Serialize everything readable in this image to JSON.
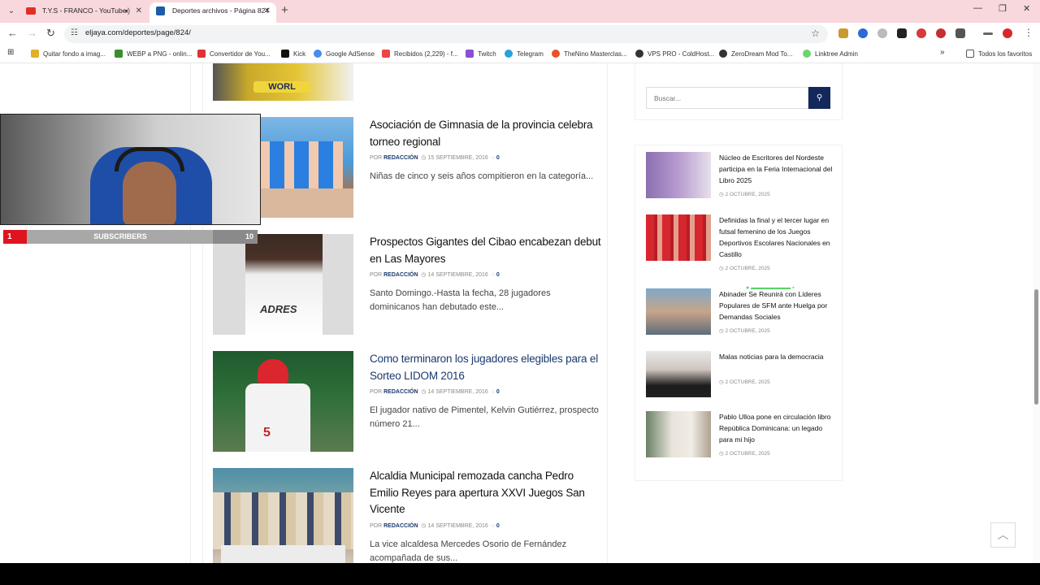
{
  "tabs": [
    {
      "title": "T.Y.S - FRANCO - YouTube"
    },
    {
      "title": "Deportes archivos - Página 824"
    }
  ],
  "address": {
    "url": "eljaya.com/deportes/page/824/"
  },
  "bookmarks": [
    {
      "label": "Quitar fondo a imag..."
    },
    {
      "label": "WEBP a PNG - onlin..."
    },
    {
      "label": "Convertidor de You..."
    },
    {
      "label": "Kick"
    },
    {
      "label": "Google AdSense"
    },
    {
      "label": "Recibidos (2,229) - f..."
    },
    {
      "label": "Twitch"
    },
    {
      "label": "Telegram"
    },
    {
      "label": "TheNino Masterclas..."
    },
    {
      "label": "VPS PRO - ColdHost..."
    },
    {
      "label": "ZeroDream Mod To..."
    },
    {
      "label": "Linktree Admin"
    }
  ],
  "bookmarks_all": "Todos los favoritos",
  "articles": [
    {
      "title": "Asociación de Gimnasia de la provincia celebra torneo regional",
      "by": "POR",
      "author": "REDACCIÓN",
      "date": "15 SEPTIEMBRE, 2016",
      "comments": "0",
      "excerpt": "Niñas de cinco y seis años compitieron en la categoría..."
    },
    {
      "title": "Prospectos Gigantes del Cibao encabezan debut en Las Mayores",
      "by": "POR",
      "author": "REDACCIÓN",
      "date": "14 SEPTIEMBRE, 2016",
      "comments": "0",
      "excerpt": "Santo Domingo.-Hasta la fecha, 28 jugadores dominicanos han debutado este..."
    },
    {
      "title": "Como terminaron los jugadores elegibles para el Sorteo LIDOM 2016",
      "by": "POR",
      "author": "REDACCIÓN",
      "date": "14 SEPTIEMBRE, 2016",
      "comments": "0",
      "excerpt": "El jugador nativo de Pimentel, Kelvin Gutiérrez, prospecto número 21..."
    },
    {
      "title": "Alcaldia Municipal remozada cancha Pedro Emilio Reyes para apertura XXVI Juegos San Vicente",
      "by": "POR",
      "author": "REDACCIÓN",
      "date": "14 SEPTIEMBRE, 2016",
      "comments": "0",
      "excerpt": "La vice alcaldesa Mercedes Osorio de Fernández acompañada de sus..."
    }
  ],
  "search": {
    "placeholder": "Buscar..."
  },
  "sidebar": [
    {
      "title": "Núcleo de Escritores del Nordeste participa en la Feria Internacional del Libro 2025",
      "date": "2 OCTUBRE, 2025"
    },
    {
      "title": "Definidas la final y el tercer lugar en futsal femenino de los Juegos Deportivos Escolares Nacionales en Castillo",
      "date": "2 OCTUBRE, 2025"
    },
    {
      "title": "Abinader Se Reunirá con Líderes Populares de SFM ante Huelga por Demandas Sociales",
      "date": "2 OCTUBRE, 2025"
    },
    {
      "title": "Malas noticias para la democracia",
      "date": "2 OCTUBRE, 2025"
    },
    {
      "title": "Pablo Ulloa pone en circulación libro República Dominicana: un legado para mi hijo",
      "date": "2 OCTUBRE, 2025"
    }
  ],
  "overlay": {
    "count_left": "1",
    "label": "SUBSCRIBERS",
    "count_right": "10"
  },
  "colors": {
    "tab_strip": "#f8d8dc",
    "accent": "#15285b",
    "sub_red": "#e0141e"
  }
}
